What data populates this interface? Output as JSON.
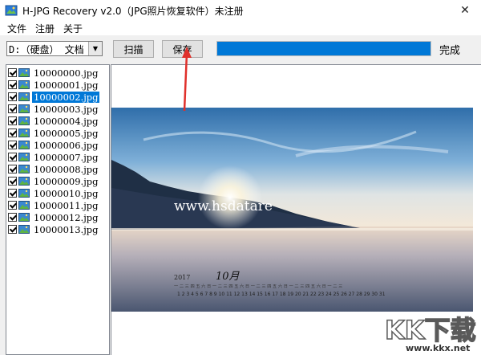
{
  "window": {
    "title": "H-JPG Recovery v2.0（JPG照片恢复软件）未注册",
    "close_symbol": "✕"
  },
  "menu": {
    "items": [
      "文件",
      "注册",
      "关于"
    ]
  },
  "toolbar": {
    "drive_value": "D:（硬盘） 文档",
    "scan_label": "扫描",
    "save_label": "保存",
    "progress_percent": 100,
    "status_text": "完成"
  },
  "files": [
    {
      "name": "10000000.jpg",
      "checked": true,
      "selected": false
    },
    {
      "name": "10000001.jpg",
      "checked": true,
      "selected": false
    },
    {
      "name": "10000002.jpg",
      "checked": true,
      "selected": true
    },
    {
      "name": "10000003.jpg",
      "checked": true,
      "selected": false
    },
    {
      "name": "10000004.jpg",
      "checked": true,
      "selected": false
    },
    {
      "name": "10000005.jpg",
      "checked": true,
      "selected": false
    },
    {
      "name": "10000006.jpg",
      "checked": true,
      "selected": false
    },
    {
      "name": "10000007.jpg",
      "checked": true,
      "selected": false
    },
    {
      "name": "10000008.jpg",
      "checked": true,
      "selected": false
    },
    {
      "name": "10000009.jpg",
      "checked": true,
      "selected": false
    },
    {
      "name": "10000010.jpg",
      "checked": true,
      "selected": false
    },
    {
      "name": "10000011.jpg",
      "checked": true,
      "selected": false
    },
    {
      "name": "10000012.jpg",
      "checked": true,
      "selected": false
    },
    {
      "name": "10000013.jpg",
      "checked": true,
      "selected": false
    }
  ],
  "preview": {
    "overlay_url": "www.hsdatare",
    "calendar_year": "2017",
    "calendar_month": "10月",
    "calendar_weekdays": "一 二 三 四 五 六 日 一 二 三 四 五 六 日 一 二 三 四 五 六 日 一 二 三 四 五 六 日 一 二 三",
    "calendar_days": "1 2 3 4 5 6 7 8 9 10 11 12 13 14 15 16 17 18 19 20 21 22 23 24 25 26 27 28 29 30 31"
  },
  "watermark": {
    "logo_text": "KK下载",
    "url": "www.kkx.net"
  },
  "colors": {
    "accent": "#0078d7",
    "annotation_arrow": "#e0302b"
  }
}
